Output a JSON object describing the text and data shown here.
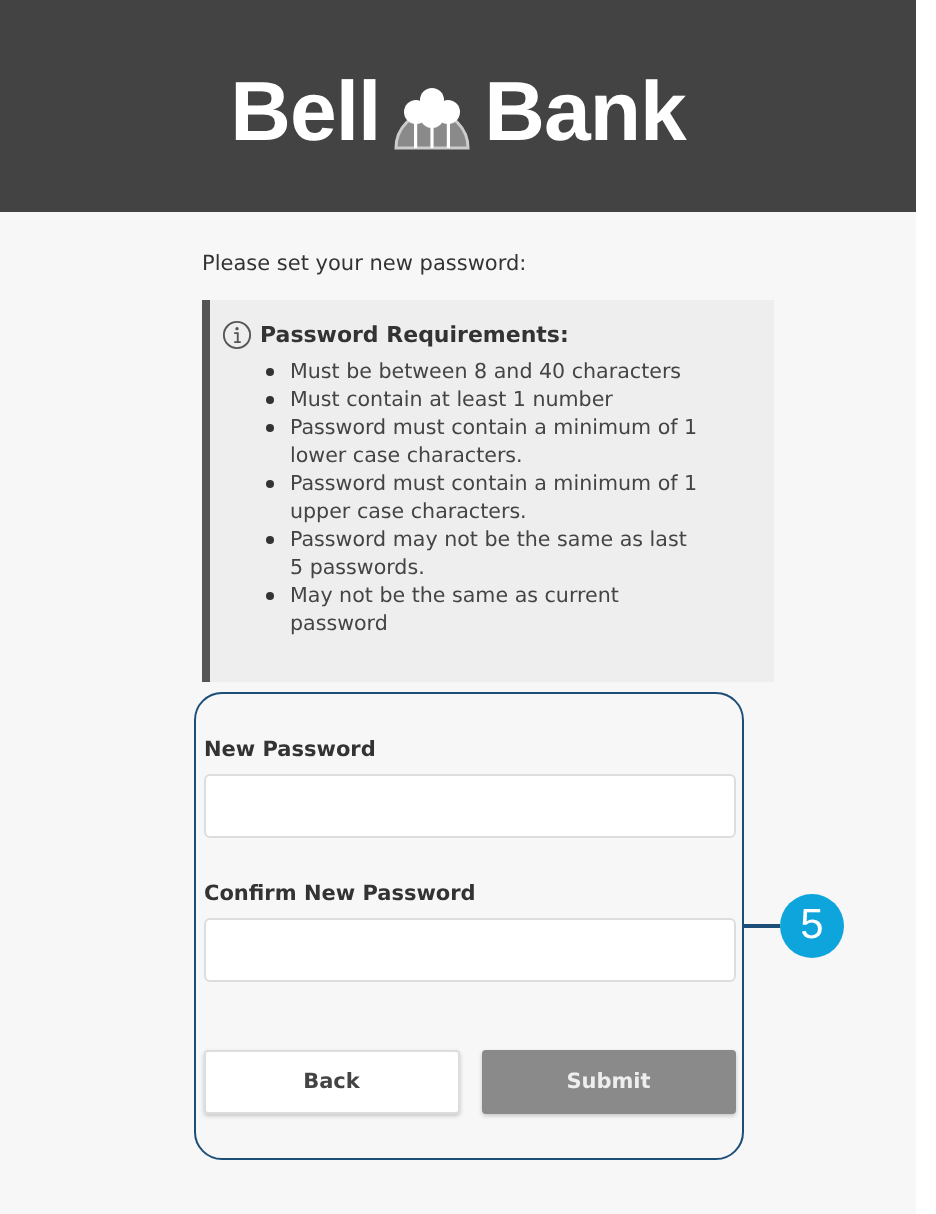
{
  "header": {
    "logo": [
      "Bell",
      "Bank"
    ]
  },
  "intro": "Please set your new password:",
  "requirements": {
    "title": "Password Requirements:",
    "items": [
      "Must be between 8 and 40 characters",
      "Must contain at least 1 number",
      "Password must contain a minimum of 1 lower case characters.",
      "Password must contain a minimum of 1 upper case characters.",
      "Password may not be the same as last 5 passwords.",
      "May not be the same as current password"
    ]
  },
  "form": {
    "fields": [
      {
        "label": "New Password"
      },
      {
        "label": "Confirm New Password"
      }
    ],
    "buttons": [
      {
        "label": "Back",
        "disabled": false
      },
      {
        "label": "Submit",
        "disabled": true
      }
    ]
  },
  "callout": {
    "number": "5"
  }
}
